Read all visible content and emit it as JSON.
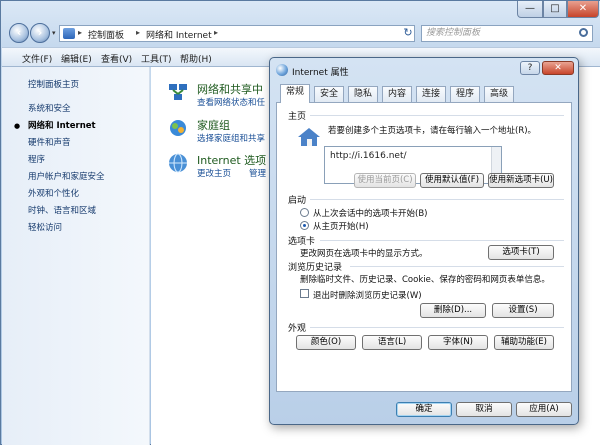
{
  "explorer": {
    "address": [
      "控制面板",
      "网络和 Internet"
    ],
    "search_placeholder": "搜索控制面板",
    "menus": [
      "文件(F)",
      "编辑(E)",
      "查看(V)",
      "工具(T)",
      "帮助(H)"
    ],
    "window_controls": {
      "minimize": "—",
      "maximize": "□",
      "close": "✕"
    }
  },
  "sidebar": {
    "items": [
      {
        "label": "控制面板主页"
      },
      {
        "label": "系统和安全"
      },
      {
        "label": "网络和 Internet",
        "current": true
      },
      {
        "label": "硬件和声音"
      },
      {
        "label": "程序"
      },
      {
        "label": "用户帐户和家庭安全"
      },
      {
        "label": "外观和个性化"
      },
      {
        "label": "时钟、语言和区域"
      },
      {
        "label": "轻松访问"
      }
    ]
  },
  "categories": [
    {
      "title": "网络和共享中",
      "links": [
        "查看网络状态和任"
      ]
    },
    {
      "title": "家庭组",
      "links": [
        "选择家庭组和共享"
      ]
    },
    {
      "title": "Internet 选项",
      "links": [
        "更改主页",
        "管理"
      ]
    }
  ],
  "dialog": {
    "title": "Internet 属性",
    "help": "?",
    "close": "✕",
    "tabs": [
      "常规",
      "安全",
      "隐私",
      "内容",
      "连接",
      "程序",
      "高级"
    ],
    "active_tab": "常规",
    "home": {
      "label": "主页",
      "desc": "若要创建多个主页选项卡，请在每行输入一个地址(R)。",
      "value": "http://i.1616.net/",
      "buttons": [
        "使用当前页(C)",
        "使用默认值(F)",
        "使用新选项卡(U)"
      ]
    },
    "startup": {
      "label": "启动",
      "options": [
        "从上次会话中的选项卡开始(B)",
        "从主页开始(H)"
      ],
      "selected": 1
    },
    "tabsgroup": {
      "label": "选项卡",
      "desc": "更改网页在选项卡中的显示方式。",
      "button": "选项卡(T)"
    },
    "history": {
      "label": "浏览历史记录",
      "desc": "删除临时文件、历史记录、Cookie、保存的密码和网页表单信息。",
      "checkbox": "退出时删除浏览历史记录(W)",
      "buttons": [
        "删除(D)...",
        "设置(S)"
      ]
    },
    "appearance": {
      "label": "外观",
      "buttons": [
        "颜色(O)",
        "语言(L)",
        "字体(N)",
        "辅助功能(E)"
      ]
    },
    "footer": [
      "确定",
      "取消",
      "应用(A)"
    ]
  }
}
